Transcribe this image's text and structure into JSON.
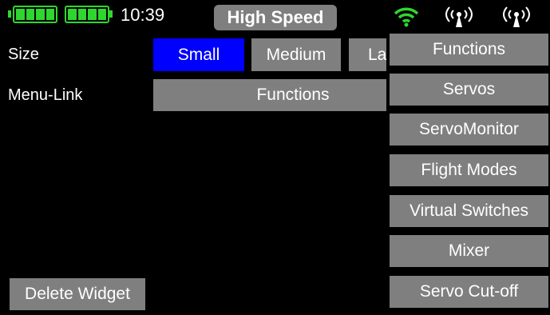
{
  "status_bar": {
    "time": "10:39",
    "mode_badge": "High Speed"
  },
  "settings": {
    "size_label": "Size",
    "size_options": [
      "Small",
      "Medium",
      "La"
    ],
    "size_selected": "Small",
    "menu_link_label": "Menu-Link",
    "menu_link_value": "Functions"
  },
  "delete_widget": "Delete Widget",
  "dropdown": {
    "items": [
      "Functions",
      "Servos",
      "ServoMonitor",
      "Flight Modes",
      "Virtual Switches",
      "Mixer",
      "Servo Cut-off"
    ]
  },
  "colors": {
    "battery": "#2fd62f",
    "selected": "#0000ff",
    "button": "#7f7f7f"
  }
}
